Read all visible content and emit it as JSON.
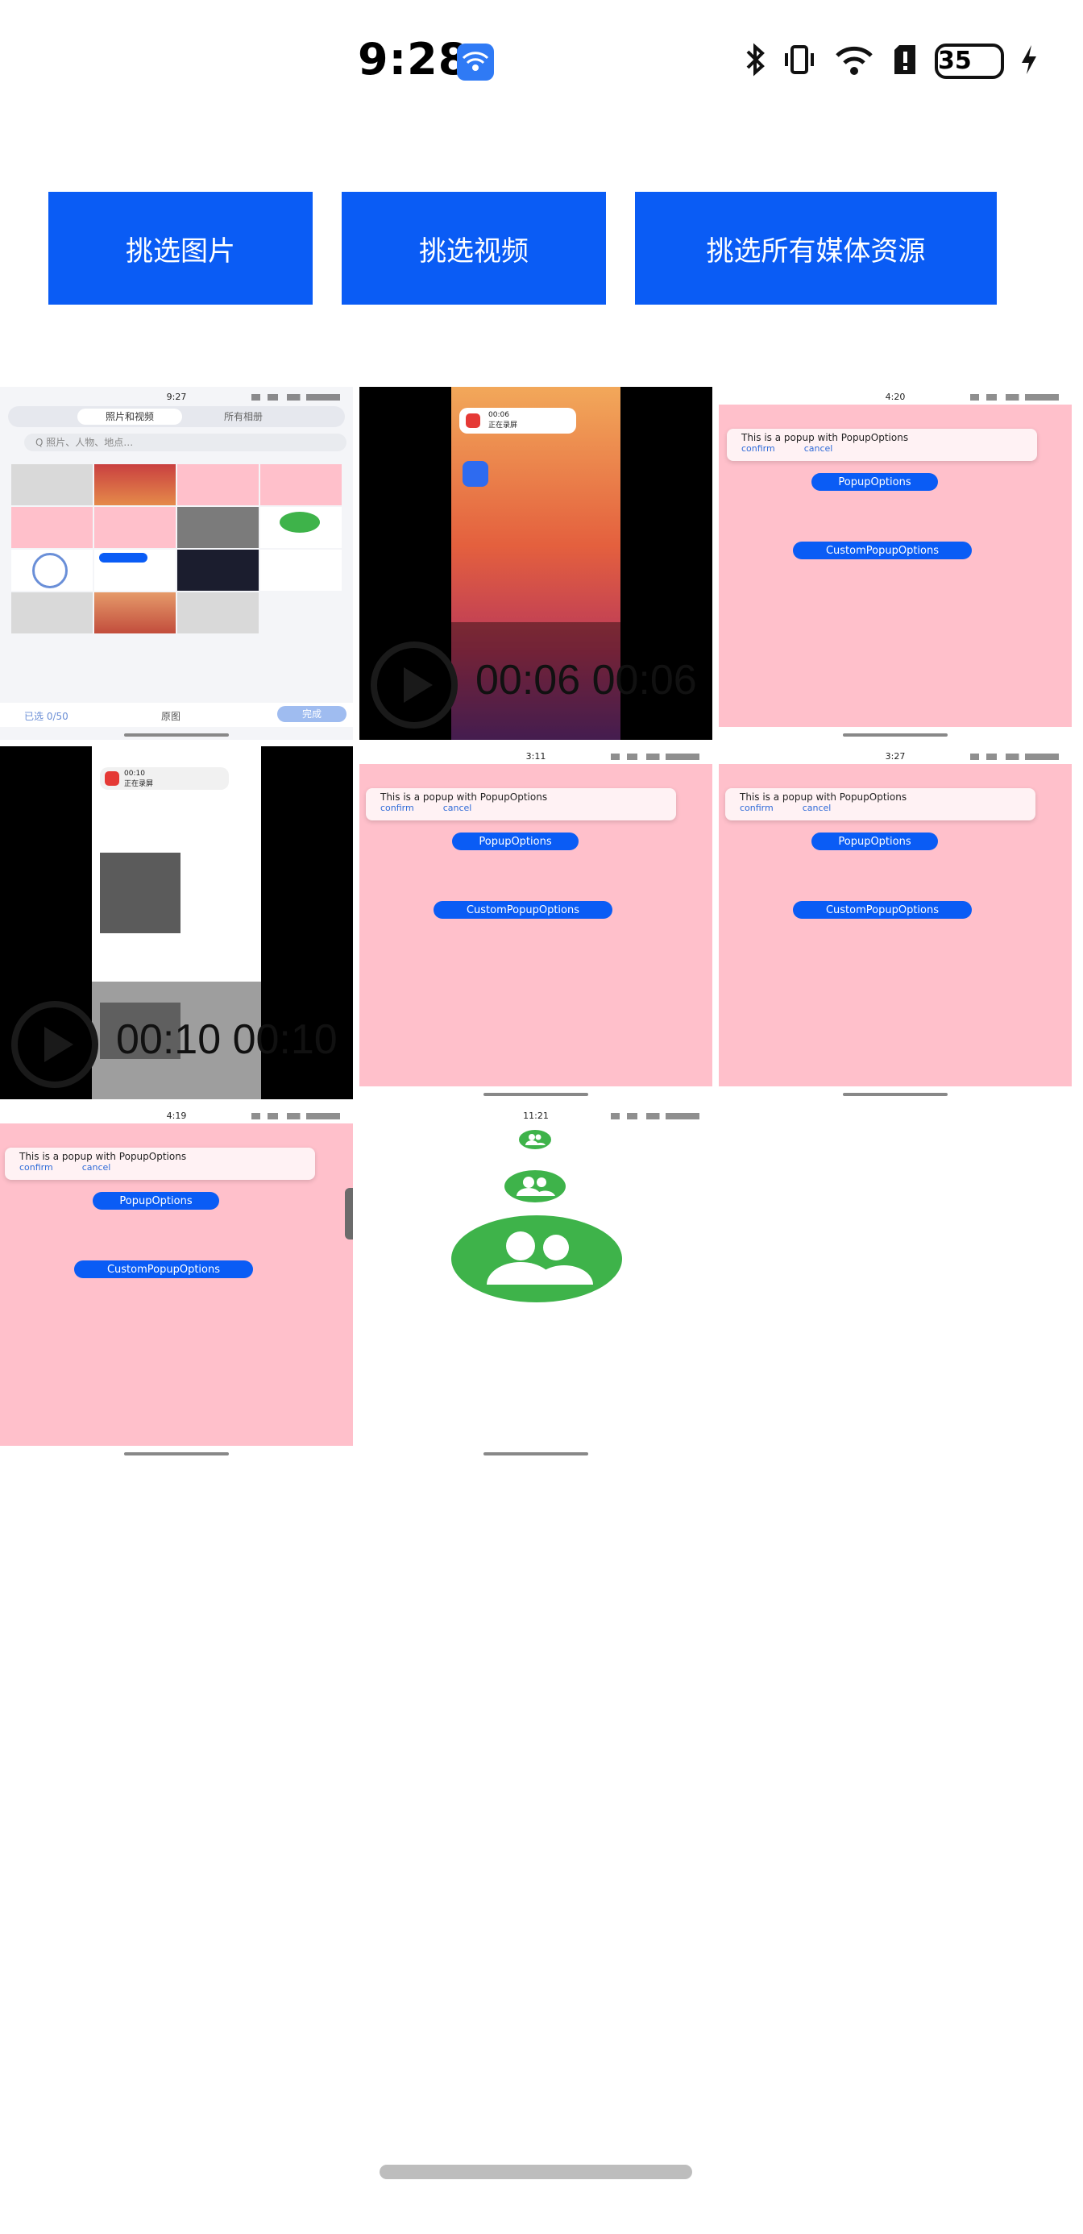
{
  "status_bar": {
    "time": "9:28",
    "hotspot_icon": "hotspot-icon",
    "battery_level": "35",
    "icons": [
      "bluetooth-icon",
      "vibrate-icon",
      "wifi-icon",
      "sim-alert-icon",
      "battery-icon",
      "charging-icon"
    ]
  },
  "actions": {
    "pick_images": "挑选图片",
    "pick_videos": "挑选视频",
    "pick_all_media": "挑选所有媒体资源"
  },
  "media_grid": {
    "items": [
      {
        "kind": "image",
        "mini_time": "9:27",
        "tab_photos": "照片和视频",
        "tab_albums": "所有相册",
        "search_placeholder": "Q 照片、人物、地点…",
        "bottom_left": "已选 0/50",
        "bottom_mid": "原图",
        "bottom_right": "完成"
      },
      {
        "kind": "video",
        "duration": "00:06 00:06",
        "overlay_time": "00:06",
        "overlay_status": "正在录屏"
      },
      {
        "kind": "image",
        "mini_time": "4:20",
        "popup_message": "This is a popup with PopupOptions",
        "confirm": "confirm",
        "cancel": "cancel",
        "popup_button": "PopupOptions",
        "custom_button": "CustomPopupOptions"
      },
      {
        "kind": "video",
        "duration": "00:10 00:10",
        "overlay_time": "00:10",
        "overlay_status": "正在录屏"
      },
      {
        "kind": "image",
        "mini_time": "3:11",
        "popup_message": "This is a popup with PopupOptions",
        "confirm": "confirm",
        "cancel": "cancel",
        "popup_button": "PopupOptions",
        "custom_button": "CustomPopupOptions"
      },
      {
        "kind": "image",
        "mini_time": "3:27",
        "popup_message": "This is a popup with PopupOptions",
        "confirm": "confirm",
        "cancel": "cancel",
        "popup_button": "PopupOptions",
        "custom_button": "CustomPopupOptions"
      },
      {
        "kind": "image",
        "mini_time": "4:19",
        "popup_message": "This is a popup with PopupOptions",
        "confirm": "confirm",
        "cancel": "cancel",
        "popup_button": "PopupOptions",
        "custom_button": "CustomPopupOptions"
      },
      {
        "kind": "image",
        "mini_time": "11:21",
        "icon": "people-icon"
      }
    ]
  },
  "colors": {
    "accent": "#0a5cf5",
    "pink": "#ffc0cb",
    "green": "#3eb34a"
  }
}
